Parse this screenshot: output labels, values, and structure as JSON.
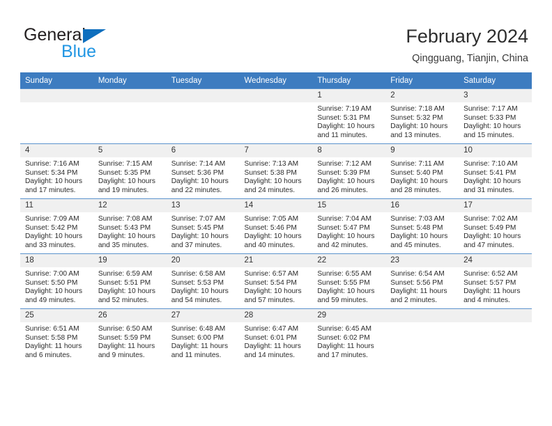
{
  "brand": {
    "name_top": "General",
    "name_bottom": "Blue",
    "triangle_icon": "blue-triangle-logo-mark",
    "accent_color": "#0f6fbe",
    "secondary_color": "#2196e3"
  },
  "header": {
    "title": "February 2024",
    "subtitle": "Qingguang, Tianjin, China"
  },
  "theme": {
    "header_blue": "#3d7cc0",
    "daynum_gray": "#f0f0f0",
    "text_color": "#2b2b2b"
  },
  "calendar": {
    "weekday_headers": [
      "Sunday",
      "Monday",
      "Tuesday",
      "Wednesday",
      "Thursday",
      "Friday",
      "Saturday"
    ],
    "weeks": [
      [
        {
          "day": "",
          "lines": []
        },
        {
          "day": "",
          "lines": []
        },
        {
          "day": "",
          "lines": []
        },
        {
          "day": "",
          "lines": []
        },
        {
          "day": "1",
          "lines": [
            "Sunrise: 7:19 AM",
            "Sunset: 5:31 PM",
            "Daylight: 10 hours",
            "and 11 minutes."
          ]
        },
        {
          "day": "2",
          "lines": [
            "Sunrise: 7:18 AM",
            "Sunset: 5:32 PM",
            "Daylight: 10 hours",
            "and 13 minutes."
          ]
        },
        {
          "day": "3",
          "lines": [
            "Sunrise: 7:17 AM",
            "Sunset: 5:33 PM",
            "Daylight: 10 hours",
            "and 15 minutes."
          ]
        }
      ],
      [
        {
          "day": "4",
          "lines": [
            "Sunrise: 7:16 AM",
            "Sunset: 5:34 PM",
            "Daylight: 10 hours",
            "and 17 minutes."
          ]
        },
        {
          "day": "5",
          "lines": [
            "Sunrise: 7:15 AM",
            "Sunset: 5:35 PM",
            "Daylight: 10 hours",
            "and 19 minutes."
          ]
        },
        {
          "day": "6",
          "lines": [
            "Sunrise: 7:14 AM",
            "Sunset: 5:36 PM",
            "Daylight: 10 hours",
            "and 22 minutes."
          ]
        },
        {
          "day": "7",
          "lines": [
            "Sunrise: 7:13 AM",
            "Sunset: 5:38 PM",
            "Daylight: 10 hours",
            "and 24 minutes."
          ]
        },
        {
          "day": "8",
          "lines": [
            "Sunrise: 7:12 AM",
            "Sunset: 5:39 PM",
            "Daylight: 10 hours",
            "and 26 minutes."
          ]
        },
        {
          "day": "9",
          "lines": [
            "Sunrise: 7:11 AM",
            "Sunset: 5:40 PM",
            "Daylight: 10 hours",
            "and 28 minutes."
          ]
        },
        {
          "day": "10",
          "lines": [
            "Sunrise: 7:10 AM",
            "Sunset: 5:41 PM",
            "Daylight: 10 hours",
            "and 31 minutes."
          ]
        }
      ],
      [
        {
          "day": "11",
          "lines": [
            "Sunrise: 7:09 AM",
            "Sunset: 5:42 PM",
            "Daylight: 10 hours",
            "and 33 minutes."
          ]
        },
        {
          "day": "12",
          "lines": [
            "Sunrise: 7:08 AM",
            "Sunset: 5:43 PM",
            "Daylight: 10 hours",
            "and 35 minutes."
          ]
        },
        {
          "day": "13",
          "lines": [
            "Sunrise: 7:07 AM",
            "Sunset: 5:45 PM",
            "Daylight: 10 hours",
            "and 37 minutes."
          ]
        },
        {
          "day": "14",
          "lines": [
            "Sunrise: 7:05 AM",
            "Sunset: 5:46 PM",
            "Daylight: 10 hours",
            "and 40 minutes."
          ]
        },
        {
          "day": "15",
          "lines": [
            "Sunrise: 7:04 AM",
            "Sunset: 5:47 PM",
            "Daylight: 10 hours",
            "and 42 minutes."
          ]
        },
        {
          "day": "16",
          "lines": [
            "Sunrise: 7:03 AM",
            "Sunset: 5:48 PM",
            "Daylight: 10 hours",
            "and 45 minutes."
          ]
        },
        {
          "day": "17",
          "lines": [
            "Sunrise: 7:02 AM",
            "Sunset: 5:49 PM",
            "Daylight: 10 hours",
            "and 47 minutes."
          ]
        }
      ],
      [
        {
          "day": "18",
          "lines": [
            "Sunrise: 7:00 AM",
            "Sunset: 5:50 PM",
            "Daylight: 10 hours",
            "and 49 minutes."
          ]
        },
        {
          "day": "19",
          "lines": [
            "Sunrise: 6:59 AM",
            "Sunset: 5:51 PM",
            "Daylight: 10 hours",
            "and 52 minutes."
          ]
        },
        {
          "day": "20",
          "lines": [
            "Sunrise: 6:58 AM",
            "Sunset: 5:53 PM",
            "Daylight: 10 hours",
            "and 54 minutes."
          ]
        },
        {
          "day": "21",
          "lines": [
            "Sunrise: 6:57 AM",
            "Sunset: 5:54 PM",
            "Daylight: 10 hours",
            "and 57 minutes."
          ]
        },
        {
          "day": "22",
          "lines": [
            "Sunrise: 6:55 AM",
            "Sunset: 5:55 PM",
            "Daylight: 10 hours",
            "and 59 minutes."
          ]
        },
        {
          "day": "23",
          "lines": [
            "Sunrise: 6:54 AM",
            "Sunset: 5:56 PM",
            "Daylight: 11 hours",
            "and 2 minutes."
          ]
        },
        {
          "day": "24",
          "lines": [
            "Sunrise: 6:52 AM",
            "Sunset: 5:57 PM",
            "Daylight: 11 hours",
            "and 4 minutes."
          ]
        }
      ],
      [
        {
          "day": "25",
          "lines": [
            "Sunrise: 6:51 AM",
            "Sunset: 5:58 PM",
            "Daylight: 11 hours",
            "and 6 minutes."
          ]
        },
        {
          "day": "26",
          "lines": [
            "Sunrise: 6:50 AM",
            "Sunset: 5:59 PM",
            "Daylight: 11 hours",
            "and 9 minutes."
          ]
        },
        {
          "day": "27",
          "lines": [
            "Sunrise: 6:48 AM",
            "Sunset: 6:00 PM",
            "Daylight: 11 hours",
            "and 11 minutes."
          ]
        },
        {
          "day": "28",
          "lines": [
            "Sunrise: 6:47 AM",
            "Sunset: 6:01 PM",
            "Daylight: 11 hours",
            "and 14 minutes."
          ]
        },
        {
          "day": "29",
          "lines": [
            "Sunrise: 6:45 AM",
            "Sunset: 6:02 PM",
            "Daylight: 11 hours",
            "and 17 minutes."
          ]
        },
        {
          "day": "",
          "lines": []
        },
        {
          "day": "",
          "lines": []
        }
      ]
    ]
  }
}
